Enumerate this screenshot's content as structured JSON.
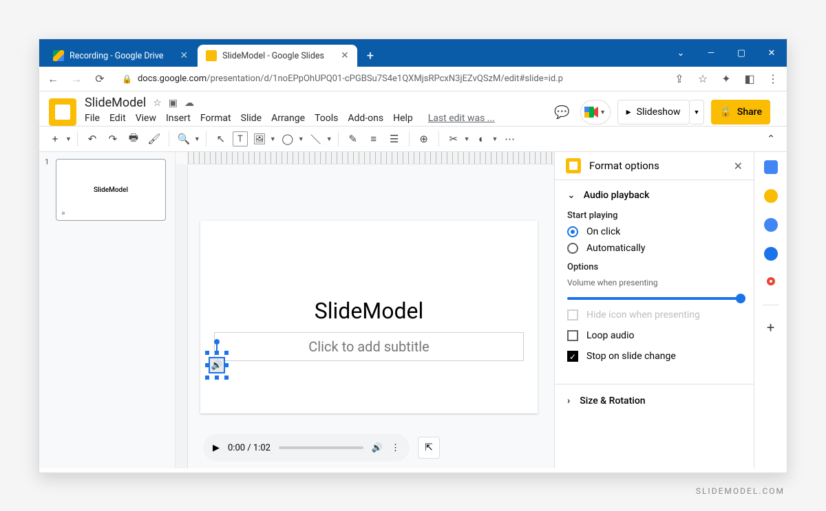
{
  "browser": {
    "tabs": [
      {
        "title": "Recording - Google Drive",
        "active": false
      },
      {
        "title": "SlideModel - Google Slides",
        "active": true
      }
    ],
    "url_domain": "docs.google.com",
    "url_path": "/presentation/d/1noEPpOhUPQ01-cPGBSu7S4e1QXMjsRPcxN3jEZvQSzM/edit#slide=id.p"
  },
  "doc": {
    "title": "SlideModel",
    "menus": [
      "File",
      "Edit",
      "View",
      "Insert",
      "Format",
      "Slide",
      "Arrange",
      "Tools",
      "Add-ons",
      "Help"
    ],
    "last_edit": "Last edit was ...",
    "slideshow_btn": "Slideshow",
    "share_btn": "Share"
  },
  "thumbs": {
    "first": {
      "num": "1",
      "title": "SlideModel"
    }
  },
  "slide": {
    "title": "SlideModel",
    "subtitle_placeholder": "Click to add subtitle"
  },
  "player": {
    "time": "0:00 / 1:02"
  },
  "format": {
    "panel_title": "Format options",
    "section_audio": "Audio playback",
    "start_playing": "Start playing",
    "opt_onclick": "On click",
    "opt_auto": "Automatically",
    "options_label": "Options",
    "volume_label": "Volume when presenting",
    "hide_icon": "Hide icon when presenting",
    "loop": "Loop audio",
    "stop": "Stop on slide change",
    "size_rotation": "Size & Rotation"
  },
  "watermark": "SLIDEMODEL.COM"
}
